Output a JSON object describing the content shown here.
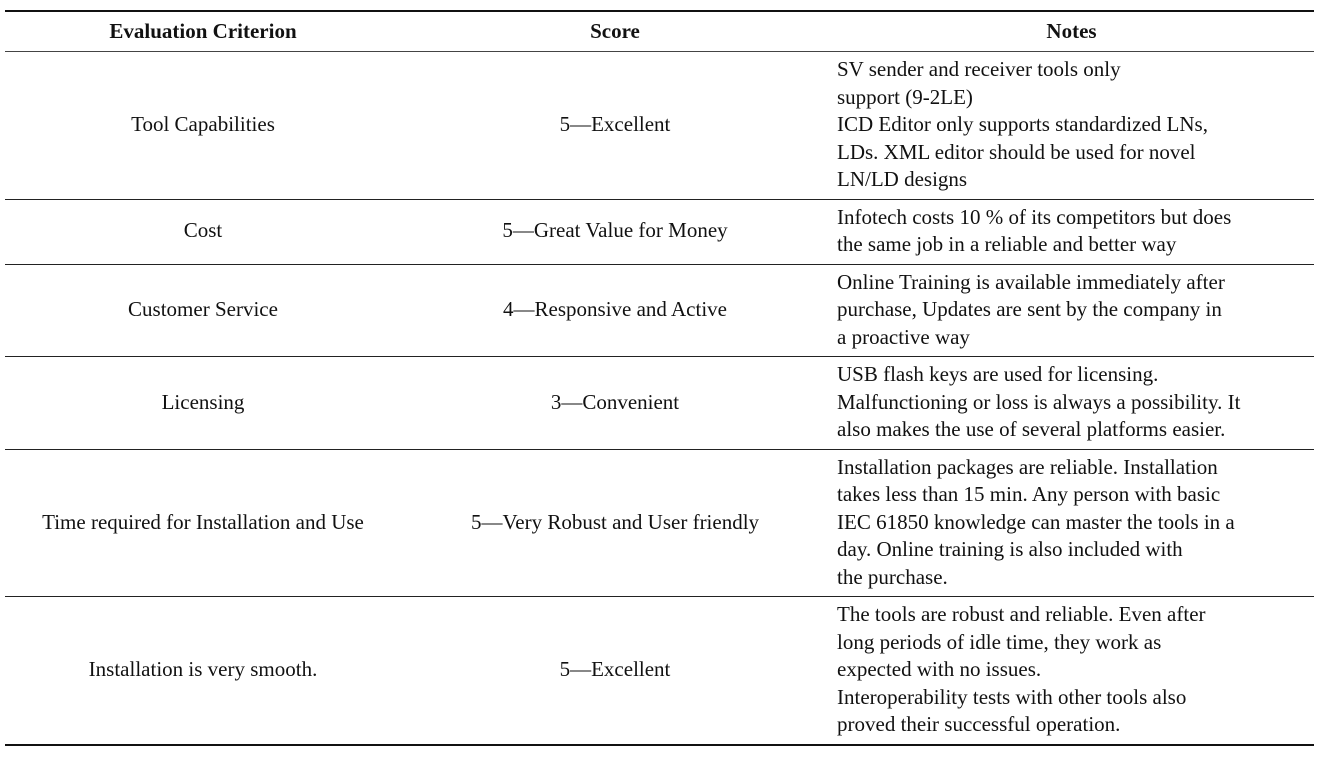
{
  "table": {
    "headers": [
      "Evaluation Criterion",
      "Score",
      "Notes"
    ],
    "rows": [
      {
        "criterion": "Tool Capabilities",
        "score": "5—Excellent",
        "notes": [
          "SV sender and receiver tools only",
          "support (9-2LE)",
          "ICD Editor only supports standardized LNs,",
          "LDs. XML editor should be used for novel",
          "LN/LD designs"
        ]
      },
      {
        "criterion": "Cost",
        "score": "5—Great Value for Money",
        "notes": [
          "Infotech costs 10 % of its competitors but does",
          "the same job in a reliable and better way"
        ]
      },
      {
        "criterion": "Customer Service",
        "score": "4—Responsive and Active",
        "notes": [
          "Online Training is available immediately after",
          "purchase, Updates are sent by the company in",
          "a proactive way"
        ]
      },
      {
        "criterion": "Licensing",
        "score": "3—Convenient",
        "notes": [
          "USB flash keys are used for licensing.",
          "Malfunctioning or loss is always a possibility. It",
          "also makes the use of several platforms easier."
        ]
      },
      {
        "criterion": "Time required for Installation and Use",
        "score": "5—Very Robust and User friendly",
        "notes": [
          "Installation packages are reliable. Installation",
          "takes less than 15 min. Any person with basic",
          "IEC 61850 knowledge can master the tools in a",
          "day. Online training is also included with",
          "the purchase."
        ]
      },
      {
        "criterion": "Installation is very smooth.",
        "score": "5—Excellent",
        "notes": [
          "The tools are robust and reliable. Even after",
          "long periods of idle time, they work as",
          "expected with no issues.",
          "Interoperability tests with other tools also",
          "proved their successful operation."
        ]
      }
    ]
  }
}
